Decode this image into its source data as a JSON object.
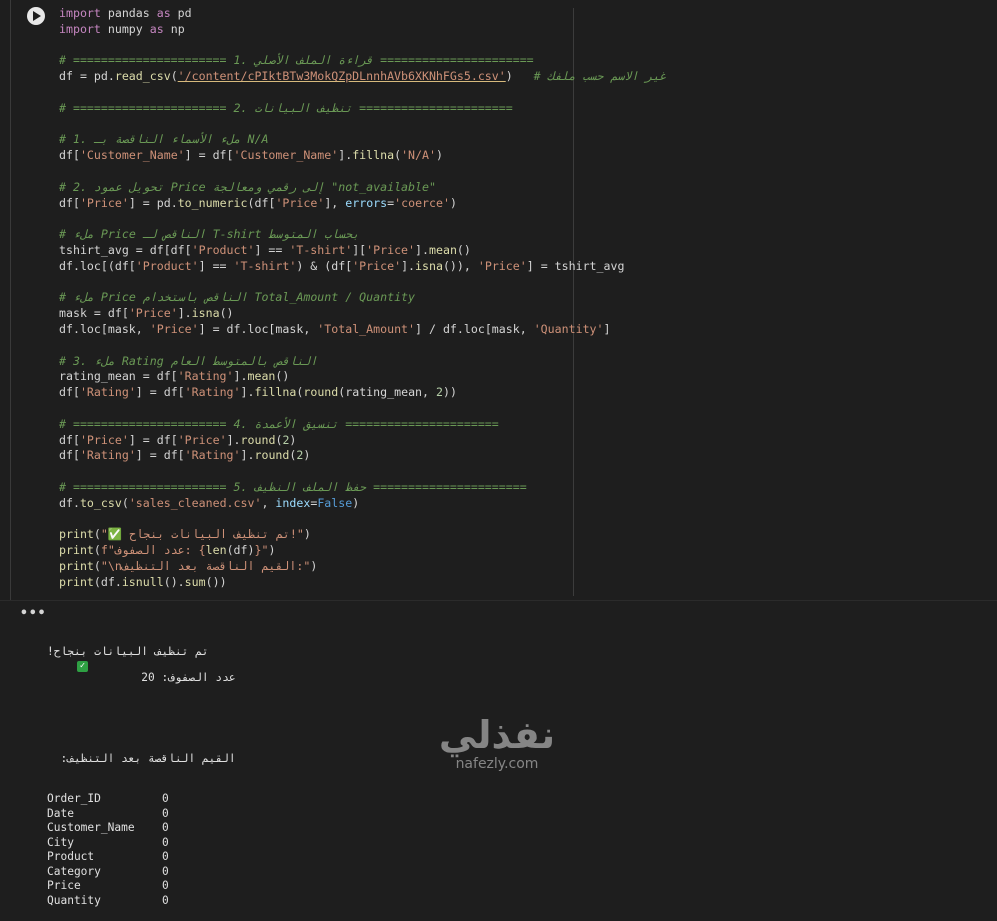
{
  "cell": {
    "run_icon": "play-icon",
    "lines": [
      [
        {
          "t": "import",
          "c": "kw"
        },
        {
          "t": " pandas ",
          "c": "mod"
        },
        {
          "t": "as",
          "c": "kw"
        },
        {
          "t": " pd",
          "c": "mod"
        }
      ],
      [
        {
          "t": "import",
          "c": "kw"
        },
        {
          "t": " numpy ",
          "c": "mod"
        },
        {
          "t": "as",
          "c": "kw"
        },
        {
          "t": " np",
          "c": "mod"
        }
      ],
      [],
      [
        {
          "t": "# ====================== 1. قراءة الملف الأصلي ======================",
          "c": "cmt"
        }
      ],
      [
        {
          "t": "df = pd.",
          "c": "mod"
        },
        {
          "t": "read_csv",
          "c": "fn"
        },
        {
          "t": "(",
          "c": "mod"
        },
        {
          "t": "'/content/cPIktBTw3MokQZpDLnnhAVb6XKNhFGs5.csv'",
          "c": "str ul"
        },
        {
          "t": ")   ",
          "c": "mod"
        },
        {
          "t": "# غير الاسم حسب ملفك",
          "c": "cmt"
        }
      ],
      [],
      [
        {
          "t": "# ====================== 2. تنظيف البيانات ======================",
          "c": "cmt"
        }
      ],
      [],
      [
        {
          "t": "# 1. ملء الأسماء الناقصة بـ N/A",
          "c": "cmt"
        }
      ],
      [
        {
          "t": "df[",
          "c": "mod"
        },
        {
          "t": "'Customer_Name'",
          "c": "str"
        },
        {
          "t": "] = df[",
          "c": "mod"
        },
        {
          "t": "'Customer_Name'",
          "c": "str"
        },
        {
          "t": "].",
          "c": "mod"
        },
        {
          "t": "fillna",
          "c": "fn"
        },
        {
          "t": "(",
          "c": "mod"
        },
        {
          "t": "'N/A'",
          "c": "str"
        },
        {
          "t": ")",
          "c": "mod"
        }
      ],
      [],
      [
        {
          "t": "# 2. تحويل عمود Price إلى رقمي ومعالجة \"not_available\"",
          "c": "cmt"
        }
      ],
      [
        {
          "t": "df[",
          "c": "mod"
        },
        {
          "t": "'Price'",
          "c": "str"
        },
        {
          "t": "] = pd.",
          "c": "mod"
        },
        {
          "t": "to_numeric",
          "c": "fn"
        },
        {
          "t": "(df[",
          "c": "mod"
        },
        {
          "t": "'Price'",
          "c": "str"
        },
        {
          "t": "], ",
          "c": "mod"
        },
        {
          "t": "errors",
          "c": "var"
        },
        {
          "t": "=",
          "c": "mod"
        },
        {
          "t": "'coerce'",
          "c": "str"
        },
        {
          "t": ")",
          "c": "mod"
        }
      ],
      [],
      [
        {
          "t": "# ملء Price الناقص لـ T-shirt بحساب المتوسط",
          "c": "cmt"
        }
      ],
      [
        {
          "t": "tshirt_avg = df[df[",
          "c": "mod"
        },
        {
          "t": "'Product'",
          "c": "str"
        },
        {
          "t": "] == ",
          "c": "mod"
        },
        {
          "t": "'T-shirt'",
          "c": "str"
        },
        {
          "t": "][",
          "c": "mod"
        },
        {
          "t": "'Price'",
          "c": "str"
        },
        {
          "t": "].",
          "c": "mod"
        },
        {
          "t": "mean",
          "c": "fn"
        },
        {
          "t": "()",
          "c": "mod"
        }
      ],
      [
        {
          "t": "df.loc[(df[",
          "c": "mod"
        },
        {
          "t": "'Product'",
          "c": "str"
        },
        {
          "t": "] == ",
          "c": "mod"
        },
        {
          "t": "'T-shirt'",
          "c": "str"
        },
        {
          "t": ") & (df[",
          "c": "mod"
        },
        {
          "t": "'Price'",
          "c": "str"
        },
        {
          "t": "].",
          "c": "mod"
        },
        {
          "t": "isna",
          "c": "fn"
        },
        {
          "t": "()), ",
          "c": "mod"
        },
        {
          "t": "'Price'",
          "c": "str"
        },
        {
          "t": "] = tshirt_avg",
          "c": "mod"
        }
      ],
      [],
      [
        {
          "t": "# ملء Price الناقص باستخدام Total_Amount / Quantity",
          "c": "cmt"
        }
      ],
      [
        {
          "t": "mask = df[",
          "c": "mod"
        },
        {
          "t": "'Price'",
          "c": "str"
        },
        {
          "t": "].",
          "c": "mod"
        },
        {
          "t": "isna",
          "c": "fn"
        },
        {
          "t": "()",
          "c": "mod"
        }
      ],
      [
        {
          "t": "df.loc[mask, ",
          "c": "mod"
        },
        {
          "t": "'Price'",
          "c": "str"
        },
        {
          "t": "] = df.loc[mask, ",
          "c": "mod"
        },
        {
          "t": "'Total_Amount'",
          "c": "str"
        },
        {
          "t": "] / df.loc[mask, ",
          "c": "mod"
        },
        {
          "t": "'Quantity'",
          "c": "str"
        },
        {
          "t": "]",
          "c": "mod"
        }
      ],
      [],
      [
        {
          "t": "# 3. ملء Rating الناقص بالمتوسط العام",
          "c": "cmt"
        }
      ],
      [
        {
          "t": "rating_mean = df[",
          "c": "mod"
        },
        {
          "t": "'Rating'",
          "c": "str"
        },
        {
          "t": "].",
          "c": "mod"
        },
        {
          "t": "mean",
          "c": "fn"
        },
        {
          "t": "()",
          "c": "mod"
        }
      ],
      [
        {
          "t": "df[",
          "c": "mod"
        },
        {
          "t": "'Rating'",
          "c": "str"
        },
        {
          "t": "] = df[",
          "c": "mod"
        },
        {
          "t": "'Rating'",
          "c": "str"
        },
        {
          "t": "].",
          "c": "mod"
        },
        {
          "t": "fillna",
          "c": "fn"
        },
        {
          "t": "(",
          "c": "mod"
        },
        {
          "t": "round",
          "c": "fn"
        },
        {
          "t": "(rating_mean, ",
          "c": "mod"
        },
        {
          "t": "2",
          "c": "num"
        },
        {
          "t": "))",
          "c": "mod"
        }
      ],
      [],
      [
        {
          "t": "# ====================== 4. تنسيق الأعمدة ======================",
          "c": "cmt"
        }
      ],
      [
        {
          "t": "df[",
          "c": "mod"
        },
        {
          "t": "'Price'",
          "c": "str"
        },
        {
          "t": "] = df[",
          "c": "mod"
        },
        {
          "t": "'Price'",
          "c": "str"
        },
        {
          "t": "].",
          "c": "mod"
        },
        {
          "t": "round",
          "c": "fn"
        },
        {
          "t": "(",
          "c": "mod"
        },
        {
          "t": "2",
          "c": "num"
        },
        {
          "t": ")",
          "c": "mod"
        }
      ],
      [
        {
          "t": "df[",
          "c": "mod"
        },
        {
          "t": "'Rating'",
          "c": "str"
        },
        {
          "t": "] = df[",
          "c": "mod"
        },
        {
          "t": "'Rating'",
          "c": "str"
        },
        {
          "t": "].",
          "c": "mod"
        },
        {
          "t": "round",
          "c": "fn"
        },
        {
          "t": "(",
          "c": "mod"
        },
        {
          "t": "2",
          "c": "num"
        },
        {
          "t": ")",
          "c": "mod"
        }
      ],
      [],
      [
        {
          "t": "# ====================== 5. حفظ الملف النظيف ======================",
          "c": "cmt"
        }
      ],
      [
        {
          "t": "df.",
          "c": "mod"
        },
        {
          "t": "to_csv",
          "c": "fn"
        },
        {
          "t": "(",
          "c": "mod"
        },
        {
          "t": "'sales_cleaned.csv'",
          "c": "str"
        },
        {
          "t": ", ",
          "c": "mod"
        },
        {
          "t": "index",
          "c": "var"
        },
        {
          "t": "=",
          "c": "mod"
        },
        {
          "t": "False",
          "c": "bool"
        },
        {
          "t": ")",
          "c": "mod"
        }
      ],
      [],
      [
        {
          "t": "print",
          "c": "fn"
        },
        {
          "t": "(",
          "c": "mod"
        },
        {
          "t": "\"✅ تم تنظيف البيانات بنجاح!\"",
          "c": "str"
        },
        {
          "t": ")",
          "c": "mod"
        }
      ],
      [
        {
          "t": "print",
          "c": "fn"
        },
        {
          "t": "(",
          "c": "mod"
        },
        {
          "t": "f\"عدد الصفوف: {",
          "c": "str"
        },
        {
          "t": "len",
          "c": "fn"
        },
        {
          "t": "(df)",
          "c": "mod"
        },
        {
          "t": "}\"",
          "c": "str"
        },
        {
          "t": ")",
          "c": "mod"
        }
      ],
      [
        {
          "t": "print",
          "c": "fn"
        },
        {
          "t": "(",
          "c": "mod"
        },
        {
          "t": "\"\\nالقيم الناقصة بعد التنظيف:\"",
          "c": "str"
        },
        {
          "t": ")",
          "c": "mod"
        }
      ],
      [
        {
          "t": "print",
          "c": "fn"
        },
        {
          "t": "(df.",
          "c": "mod"
        },
        {
          "t": "isnull",
          "c": "fn"
        },
        {
          "t": "().",
          "c": "mod"
        },
        {
          "t": "sum",
          "c": "fn"
        },
        {
          "t": "())",
          "c": "mod"
        }
      ]
    ]
  },
  "output": {
    "more_label": "•••",
    "success_msg": "تم تنظيف البيانات بنجاح!",
    "rows_line": "عدد الصفوف: 20",
    "missing_header": "القيم الناقصة بعد التنظيف:",
    "table": [
      {
        "col": "Order_ID",
        "val": "0"
      },
      {
        "col": "Date",
        "val": "0"
      },
      {
        "col": "Customer_Name",
        "val": "0"
      },
      {
        "col": "City",
        "val": "0"
      },
      {
        "col": "Product",
        "val": "0"
      },
      {
        "col": "Category",
        "val": "0"
      },
      {
        "col": "Price",
        "val": "0"
      },
      {
        "col": "Quantity",
        "val": "0"
      }
    ]
  },
  "watermark": {
    "arabic": "نفذلي",
    "latin": "nafezly.com"
  }
}
